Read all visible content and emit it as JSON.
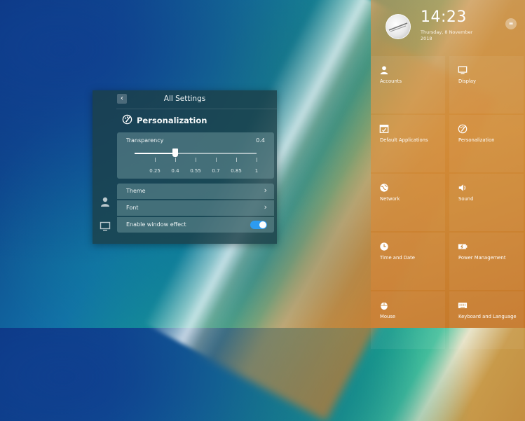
{
  "settings_window": {
    "title": "All Settings",
    "back_glyph": "‹",
    "section_title": "Personalization",
    "transparency": {
      "label": "Transparency",
      "value_text": "0.4",
      "value": 0.4,
      "min": 0.1,
      "max": 1.0,
      "tick_labels": [
        "0.25",
        "0.4",
        "0.55",
        "0.7",
        "0.85",
        "1"
      ]
    },
    "rows": {
      "theme": "Theme",
      "font": "Font",
      "window_effect": "Enable window effect"
    },
    "window_effect_enabled": true,
    "chevron_glyph": "›"
  },
  "panel": {
    "time": "14:23",
    "date": "Thursday, 8 November 2018",
    "menu_glyph": "≡",
    "tiles": [
      {
        "label": "Accounts",
        "icon": "user-icon"
      },
      {
        "label": "Display",
        "icon": "monitor-icon"
      },
      {
        "label": "Default Applications",
        "icon": "default-apps-icon"
      },
      {
        "label": "Personalization",
        "icon": "palette-icon"
      },
      {
        "label": "Network",
        "icon": "globe-icon"
      },
      {
        "label": "Sound",
        "icon": "speaker-icon"
      },
      {
        "label": "Time and Date",
        "icon": "clock-icon"
      },
      {
        "label": "Power Management",
        "icon": "battery-icon"
      },
      {
        "label": "Mouse",
        "icon": "mouse-icon"
      },
      {
        "label": "Keyboard and Language",
        "icon": "keyboard-icon"
      }
    ]
  },
  "colors": {
    "toggle_on": "#2d9bf0",
    "panel_tint": "#d08e3c",
    "window_bg": "#1c4048"
  }
}
